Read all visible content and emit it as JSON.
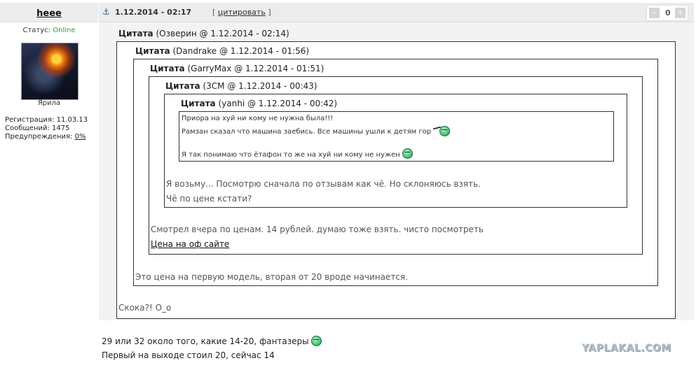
{
  "user": {
    "nick": "heee",
    "status_label": "Статус:",
    "status_value": "Online",
    "avatar_caption": "Ярила",
    "registration": "Регистрация: 11.03.13",
    "messages": "Сообщений: 1475",
    "warnings_label": "Предупреждения:",
    "warnings_value": "0%"
  },
  "post": {
    "anchor_icon": "anchor-icon",
    "date": "1.12.2014 - 02:17",
    "quote_link_prefix": "[",
    "quote_link": "цитировать",
    "quote_link_suffix": "]",
    "votes": "0",
    "vote_down_icon": "minus-icon",
    "vote_up_icon": "plus-icon"
  },
  "quotes": {
    "title_word": "Цитата",
    "q1": {
      "meta": "(Озверин @ 1.12.2014 - 02:14)",
      "reply": "Скока?! О_о"
    },
    "q2": {
      "meta": "(Dandrake @ 1.12.2014 - 01:56)",
      "reply": "Это цена на первую модель, вторая от 20 вроде начинается."
    },
    "q3": {
      "meta": "(GarryMax @ 1.12.2014 - 01:51)",
      "reply": "Смотрел вчера по ценам. 14 рублей. думаю тоже взять. чисто посмотреть",
      "link": "Цена на оф сайте"
    },
    "q4": {
      "meta": "(3СМ @ 1.12.2014 - 00:43)",
      "reply1": "Я возьму... Посмотрю сначала по отзывам как чё. Но склоняюсь взять.",
      "reply2": "Чё по цене кстати?"
    },
    "q5": {
      "meta": "(yanhi @ 1.12.2014 - 00:42)",
      "line1": "Приора на хуй ни кому не нужна была!!!",
      "line2": "Рамзан сказал что машина заебись. Все машины ушли к детям гор",
      "line3": "Я так понимаю что ётафон то же на хуй ни кому не нужен"
    }
  },
  "reply": {
    "line1": "29 или 32 около того, какие 14-20, фантазеры",
    "line2": "Первый на выходе стоил 20, сейчас 14"
  },
  "watermark": "YAPLAKAL.COM",
  "colors": {
    "online": "#2aa52a",
    "header_bg": "#ececec",
    "post_bg": "#f3f3f3"
  }
}
